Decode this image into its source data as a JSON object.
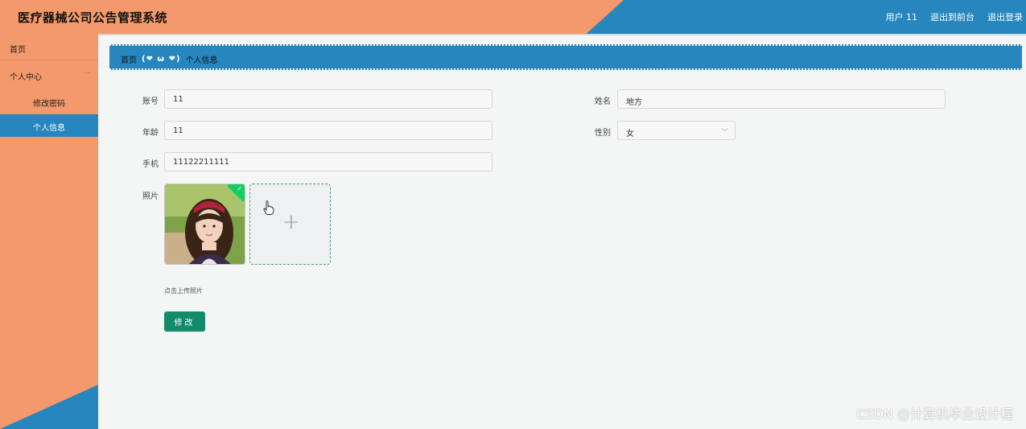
{
  "app": {
    "title": "医疗器械公司公告管理系统"
  },
  "header": {
    "user_label": "用户 11",
    "front_link": "退出到前台",
    "logout_link": "退出登录"
  },
  "sidebar": {
    "home": "首页",
    "group": "个人中心",
    "items": [
      {
        "label": "修改密码"
      },
      {
        "label": "个人信息",
        "active": true
      }
    ]
  },
  "breadcrumb": {
    "home": "首页",
    "separator": "(❤ ω ❤)",
    "current": "个人信息"
  },
  "form": {
    "account": {
      "label": "账号",
      "value": "11"
    },
    "name": {
      "label": "姓名",
      "value": "地方"
    },
    "age": {
      "label": "年龄",
      "value": "11"
    },
    "gender": {
      "label": "性别",
      "value": "女"
    },
    "phone": {
      "label": "手机",
      "value": "11122211111"
    },
    "photo": {
      "label": "照片",
      "hint": "点击上传照片",
      "upload_symbol": "+"
    },
    "submit_label": "修改"
  },
  "watermark": "CSDN @计算机毕业设计程",
  "colors": {
    "orange": "#f4996b",
    "blue": "#2686bd",
    "button_green": "#138b6b"
  }
}
